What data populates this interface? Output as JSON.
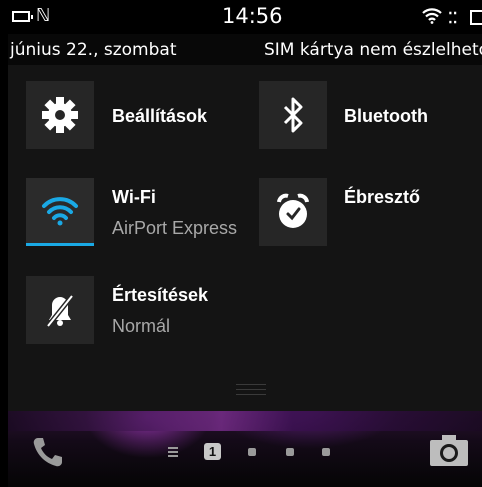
{
  "status_bar": {
    "time": "14:56",
    "icons": [
      "battery-icon",
      "nfc-icon",
      "wifi-signal-icon",
      "blackberry-messenger-icon",
      "cellular-icon"
    ]
  },
  "notification_bar": {
    "date": "június 22., szombat",
    "sim_status": "SIM kártya nem észlelhető"
  },
  "quick_settings": {
    "settings": {
      "label": "Beállítások",
      "icon": "gear-icon"
    },
    "bluetooth": {
      "label": "Bluetooth",
      "icon": "bluetooth-icon"
    },
    "wifi": {
      "label": "Wi-Fi",
      "network": "AirPort Express",
      "icon": "wifi-icon",
      "active": true,
      "accent": "#1aa9e5"
    },
    "alarm": {
      "label": "Ébresztő",
      "icon": "alarm-clock-icon"
    },
    "notifications": {
      "label": "Értesítések",
      "mode": "Normál",
      "icon": "bell-muted-icon"
    }
  },
  "dock": {
    "page_indicator": "1",
    "icons": [
      "phone-icon",
      "menu-icon",
      "camera-icon"
    ]
  }
}
